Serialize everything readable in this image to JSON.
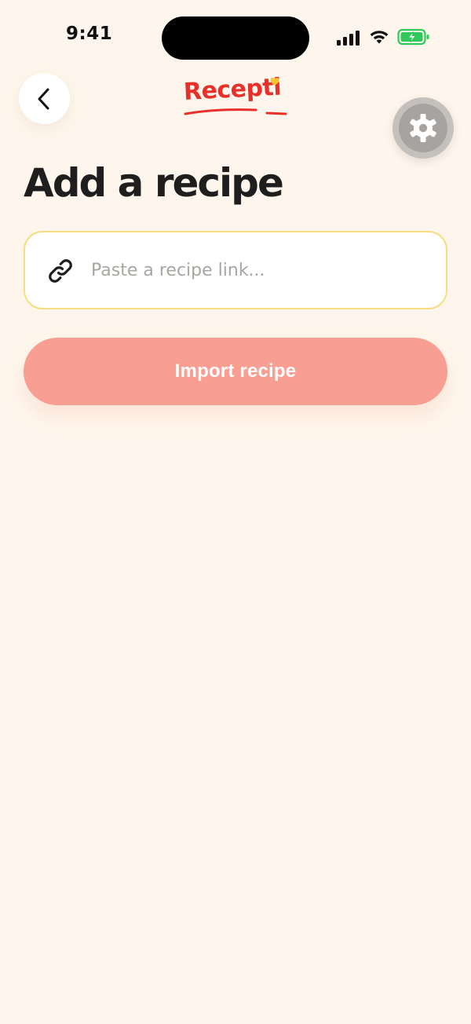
{
  "status_bar": {
    "time": "9:41"
  },
  "header": {
    "logo_text": "Recepti",
    "back_icon": "chevron-left-icon",
    "settings_icon": "gear-icon"
  },
  "page": {
    "title": "Add a recipe"
  },
  "link_field": {
    "placeholder": "Paste a recipe link...",
    "value": "",
    "icon": "link-icon"
  },
  "import_button": {
    "label": "Import recipe"
  },
  "colors": {
    "background": "#FEF6EC",
    "brand_red": "#E8302A",
    "accent_yellow": "#F6DD7F",
    "button_disabled_salmon": "#F99E92",
    "battery_green": "#30C85A"
  }
}
